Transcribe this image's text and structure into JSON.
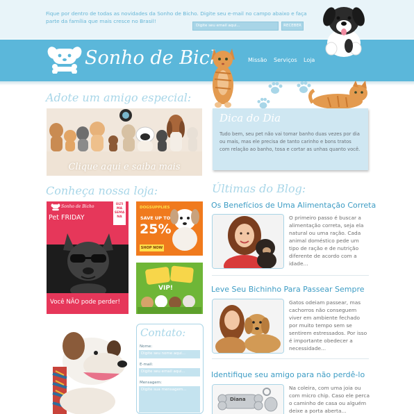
{
  "topbar": {
    "message": "Fique por dentro de todas as novidades da Sonho de Bicho. Digite seu e-mail no campo abaixo e faça parte da família que mais cresce no Brasil!",
    "email_placeholder": "Digite seu email aqui...",
    "subscribe_label": "RECEBER"
  },
  "brand": {
    "name": "Sonho de Bicho"
  },
  "nav": [
    {
      "label": "Missão"
    },
    {
      "label": "Serviços"
    },
    {
      "label": "Loja"
    }
  ],
  "adopt": {
    "title": "Adote um amigo especial:",
    "cta": "Clique aqui e saiba mais"
  },
  "tip": {
    "title": "Dica do Dia",
    "body": "Tudo bem, seu pet não vai tomar banho duas vezes por dia ou mais, mas ele precisa de tanto carinho e bons tratos com relação ao banho, tosa e cortar as unhas quanto você."
  },
  "store": {
    "title": "Conheça nossa loja:",
    "friday_promo": {
      "brand": "Sonho de Bicho",
      "ribbon": [
        "ÚLTI",
        "MA",
        "SEMA",
        "NA"
      ],
      "headline": "Pet FRIDAY",
      "footer": "Você NÃO pode perder!"
    },
    "dogsupplies_promo": {
      "brand": "DOGSUPPLIES",
      "save_text": "SAVE UP TO",
      "percent": "25%",
      "button": "SHOP NOW"
    },
    "vip_promo": {
      "text": "VIP!"
    }
  },
  "blog": {
    "title": "Últimas do Blog:",
    "posts": [
      {
        "title": "Os Benefícios de Uma Alimentação Correta",
        "excerpt": "O primeiro passo é buscar a alimentação correta, seja ela natural ou uma ração. Cada animal doméstico pede um tipo de ração e de nutrição diferente de acordo com a idade..."
      },
      {
        "title": "Leve Seu Bichinho Para Passear Sempre",
        "excerpt": "Gatos odeiam passear, mas cachorros não conseguem viver em ambiente fechado por muito tempo sem se sentirem estressados. Por isso é importante obedecer a necessidade..."
      },
      {
        "title": "Identifique seu amigo para não perdê-lo",
        "excerpt": "Na coleira, com uma joia ou com micro chip. Caso ele perca o caminho de casa ou alguém deixe a porta aberta..."
      }
    ],
    "tag_name": "Diana"
  },
  "contact": {
    "title": "Contato:",
    "name_label": "Nome:",
    "name_placeholder": "Digite seu nome aqui...",
    "email_label": "E-mail:",
    "email_placeholder": "Digite seu email aqui...",
    "message_label": "Mensagem:",
    "message_placeholder": "Digite sua mensagem..."
  },
  "colors": {
    "header_blue": "#5bb7da",
    "light_blue": "#a8d6e8",
    "link_blue": "#3d9cc4",
    "promo_red": "#e6375a",
    "promo_orange": "#f07a1d",
    "promo_green": "#6fb637"
  }
}
